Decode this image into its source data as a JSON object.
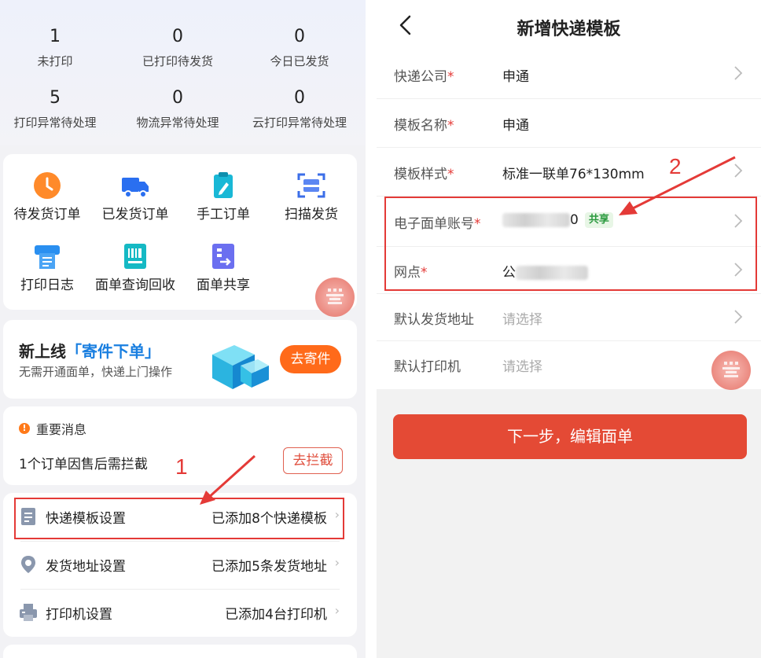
{
  "left": {
    "stats": [
      {
        "num": "1",
        "label": "未打印"
      },
      {
        "num": "0",
        "label": "已打印待发货"
      },
      {
        "num": "0",
        "label": "今日已发货"
      },
      {
        "num": "5",
        "label": "打印异常待处理"
      },
      {
        "num": "0",
        "label": "物流异常待处理"
      },
      {
        "num": "0",
        "label": "云打印异常待处理"
      }
    ],
    "quick_actions": [
      {
        "label": "待发货订单",
        "icon": "clock-icon"
      },
      {
        "label": "已发货订单",
        "icon": "truck-icon"
      },
      {
        "label": "手工订单",
        "icon": "clipboard-pen-icon"
      },
      {
        "label": "扫描发货",
        "icon": "scan-icon"
      },
      {
        "label": "打印日志",
        "icon": "print-log-icon"
      },
      {
        "label": "面单查询回收",
        "icon": "barcode-icon"
      },
      {
        "label": "面单共享",
        "icon": "share-icon"
      }
    ],
    "seal_text": "商家版",
    "promo": {
      "title_prefix": "新上线",
      "title_highlight": "「寄件下单」",
      "subtitle": "无需开通面单，快递上门操作",
      "button": "去寄件"
    },
    "notice": {
      "heading": "重要消息",
      "message": "1个订单因售后需拦截",
      "button": "去拦截"
    },
    "settings": [
      {
        "label": "快递模板设置",
        "value": "已添加8个快递模板",
        "icon": "template-icon"
      },
      {
        "label": "发货地址设置",
        "value": "已添加5条发货地址",
        "icon": "location-icon"
      },
      {
        "label": "打印机设置",
        "value": "已添加4台打印机",
        "icon": "printer-icon"
      }
    ],
    "annotation_number": "1"
  },
  "right": {
    "title": "新增快递模板",
    "fields": [
      {
        "label": "快递公司",
        "required": "*",
        "value": "申通"
      },
      {
        "label": "模板名称",
        "required": "*",
        "value": "申通"
      },
      {
        "label": "模板样式",
        "required": "*",
        "value": "标准一联单76*130mm"
      },
      {
        "label": "电子面单账号",
        "required": "*",
        "value_prefix": "",
        "value_suffix": "0",
        "tag": "共享"
      },
      {
        "label": "网点",
        "required": "*",
        "value_prefix": "公"
      },
      {
        "label": "默认发货地址",
        "required": "",
        "placeholder": "请选择"
      },
      {
        "label": "默认打印机",
        "required": "",
        "placeholder": "请选择"
      }
    ],
    "next_button": "下一步，编辑面单",
    "annotation_number": "2",
    "seal_text": "商家版"
  },
  "colors": {
    "accent_red": "#e44a35",
    "annotation_red": "#e43a37",
    "promo_orange": "#ff6a1a",
    "highlight_blue": "#1a7fe0",
    "share_green": "#2b9a3f"
  }
}
